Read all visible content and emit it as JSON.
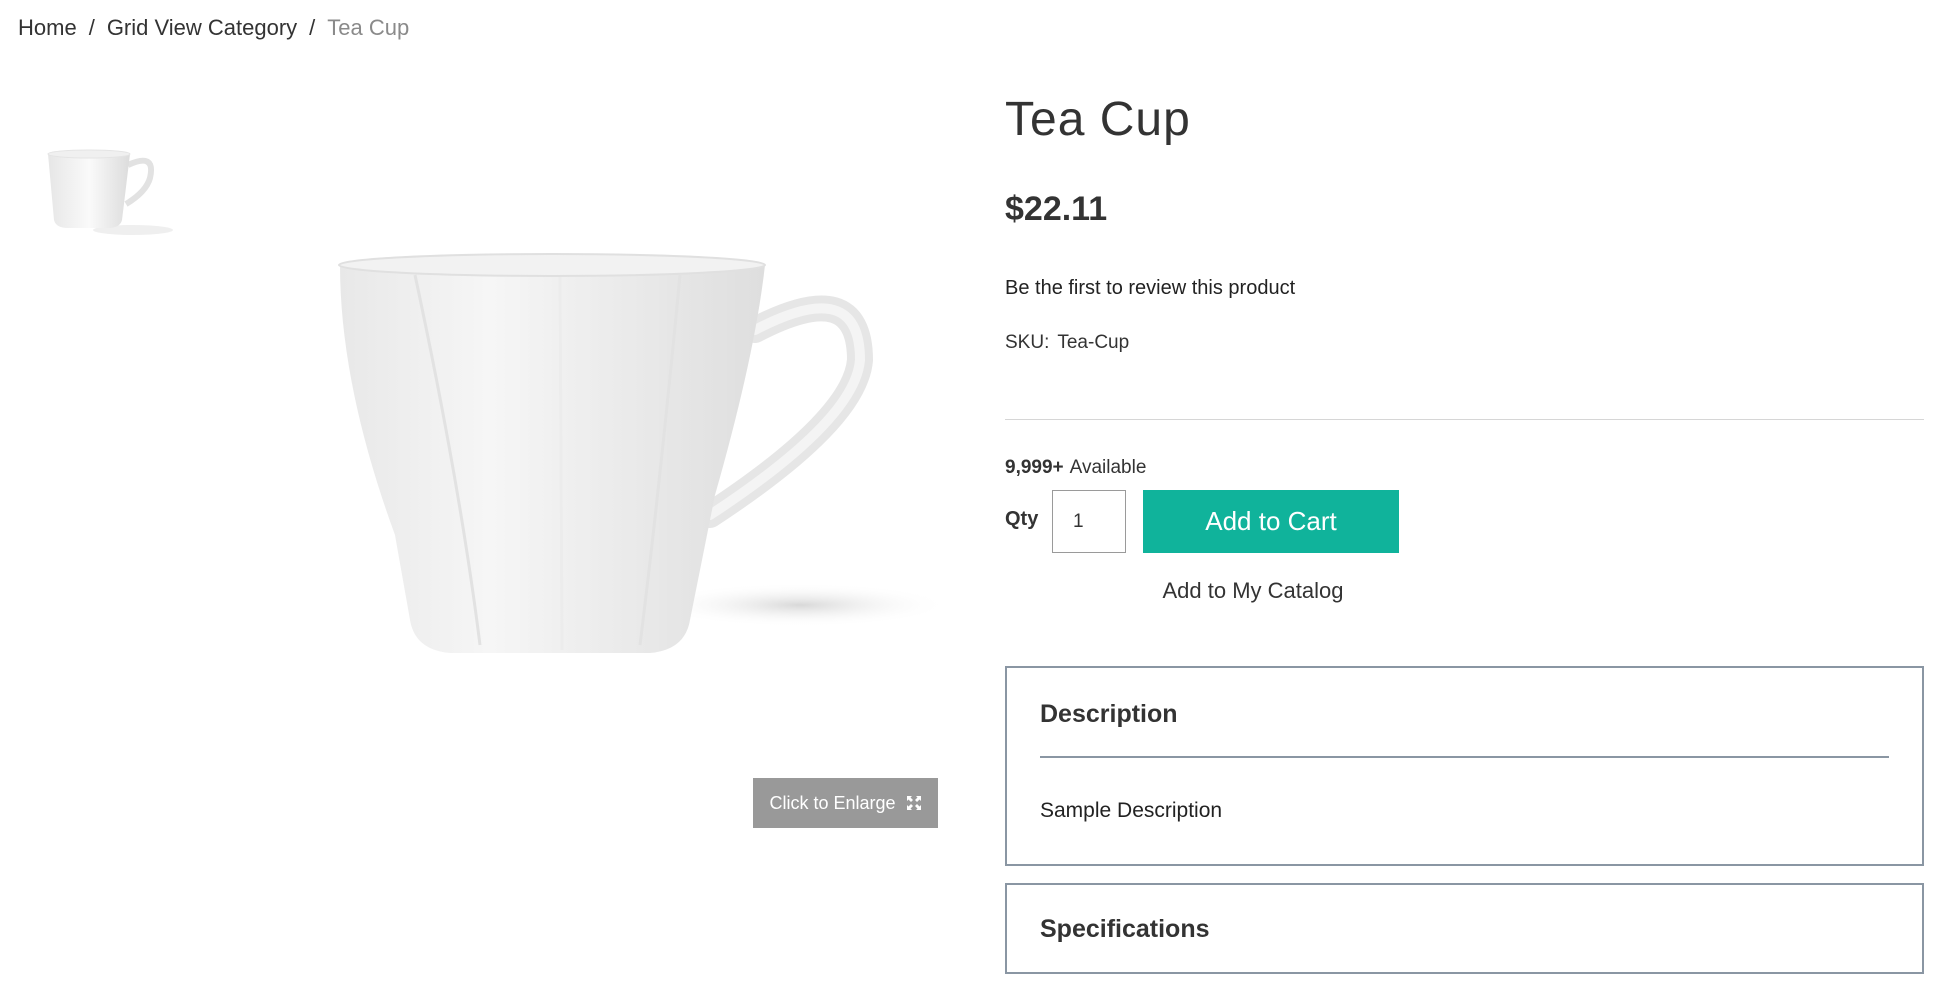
{
  "breadcrumb": {
    "items": [
      "Home",
      "Grid View Category"
    ],
    "separator": "/",
    "current": "Tea Cup"
  },
  "gallery": {
    "thumbnail_icon": "tea-cup-image",
    "main_image_icon": "tea-cup-image",
    "enlarge_label": "Click to Enlarge",
    "enlarge_icon": "expand-icon"
  },
  "product": {
    "title": "Tea Cup",
    "price": "$22.11",
    "review_link": "Be the first to review this product",
    "sku_label": "SKU:",
    "sku_value": "Tea-Cup"
  },
  "purchase": {
    "available_count": "9,999+",
    "available_label": "Available",
    "qty_label": "Qty",
    "qty_value": "1",
    "add_to_cart": "Add to Cart",
    "add_to_catalog": "Add to My Catalog"
  },
  "tabs": {
    "description_title": "Description",
    "description_body": "Sample Description",
    "specifications_title": "Specifications"
  },
  "colors": {
    "accent": "#10b39b",
    "enlarge_bg": "#999999",
    "panel_border": "#8a96a3"
  }
}
